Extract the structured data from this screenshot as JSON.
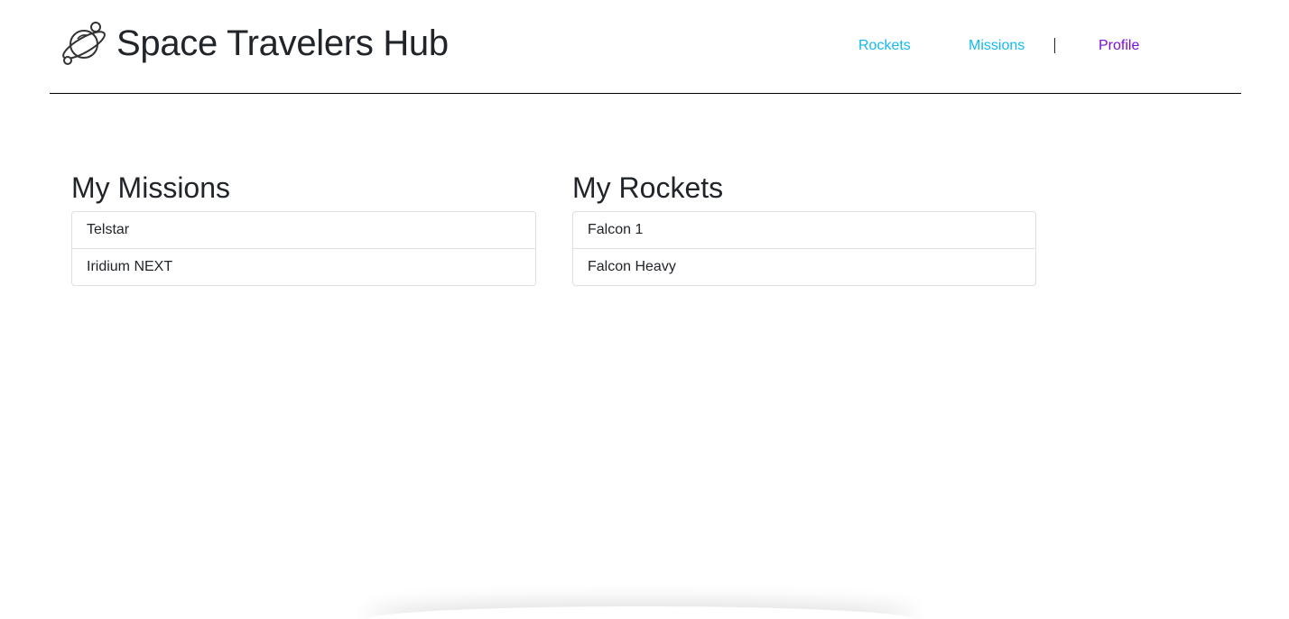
{
  "header": {
    "logo_icon": "planet-icon",
    "title": "Space Travelers Hub",
    "nav": {
      "rockets": "Rockets",
      "missions": "Missions",
      "profile": "Profile"
    },
    "colors": {
      "nav_link": "#13b9f0",
      "nav_active": "#7d0bd6"
    }
  },
  "profile": {
    "missions": {
      "title": "My Missions",
      "items": [
        "Telstar",
        "Iridium NEXT"
      ]
    },
    "rockets": {
      "title": "My Rockets",
      "items": [
        "Falcon 1",
        "Falcon Heavy"
      ]
    }
  }
}
